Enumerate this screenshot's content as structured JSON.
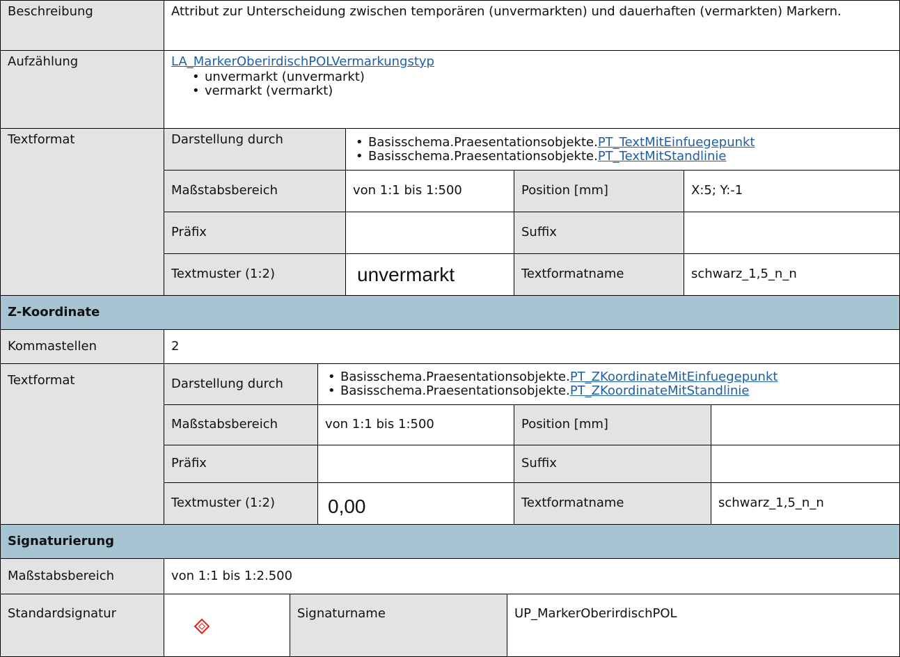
{
  "beschreibung": {
    "label": "Beschreibung",
    "value": "Attribut zur Unterscheidung zwischen temporären (unvermarkten) und dauerhaften (vermarkten) Markern."
  },
  "aufzaehlung": {
    "label": "Aufzählung",
    "link": "LA_MarkerOberirdischPOLVermarkungstyp",
    "items": [
      "unvermarkt (unvermarkt)",
      "vermarkt (vermarkt)"
    ]
  },
  "textformat1": {
    "label": "Textformat",
    "darstellung_label": "Darstellung durch",
    "darstellung": [
      {
        "prefix": "Basisschema.Praesentationsobjekte.",
        "link": "PT_TextMitEinfuegepunkt"
      },
      {
        "prefix": "Basisschema.Praesentationsobjekte.",
        "link": "PT_TextMitStandlinie"
      }
    ],
    "massstab_label": "Maßstabsbereich",
    "massstab": "von 1:1 bis 1:500",
    "position_label": "Position [mm]",
    "position": "X:5; Y:-1",
    "praefix_label": "Präfix",
    "praefix": "",
    "suffix_label": "Suffix",
    "suffix": "",
    "textmuster_label": "Textmuster (1:2)",
    "textmuster": "unvermarkt",
    "textformatname_label": "Textformatname",
    "textformatname": "schwarz_1,5_n_n"
  },
  "z_header": "Z-Koordinate",
  "kommastellen": {
    "label": "Kommastellen",
    "value": "2"
  },
  "textformat2": {
    "label": "Textformat",
    "darstellung_label": "Darstellung durch",
    "darstellung": [
      {
        "prefix": "Basisschema.Praesentationsobjekte.",
        "link": "PT_ZKoordinateMitEinfuegepunkt"
      },
      {
        "prefix": "Basisschema.Praesentationsobjekte.",
        "link": "PT_ZKoordinateMitStandlinie"
      }
    ],
    "massstab_label": "Maßstabsbereich",
    "massstab": "von 1:1 bis 1:500",
    "position_label": "Position [mm]",
    "position": "",
    "praefix_label": "Präfix",
    "praefix": "",
    "suffix_label": "Suffix",
    "suffix": "",
    "textmuster_label": "Textmuster (1:2)",
    "textmuster": "0,00",
    "textformatname_label": "Textformatname",
    "textformatname": "schwarz_1,5_n_n"
  },
  "sig_header": "Signaturierung",
  "sig_massstab": {
    "label": "Maßstabsbereich",
    "value": "von 1:1 bis 1:2.500"
  },
  "standardsignatur": {
    "label": "Standardsignatur",
    "symbol_icon": "red-diamond-marker-icon",
    "symbol_color": "#e0201b",
    "signaturname_label": "Signaturname",
    "signaturname": "UP_MarkerOberirdischPOL"
  }
}
